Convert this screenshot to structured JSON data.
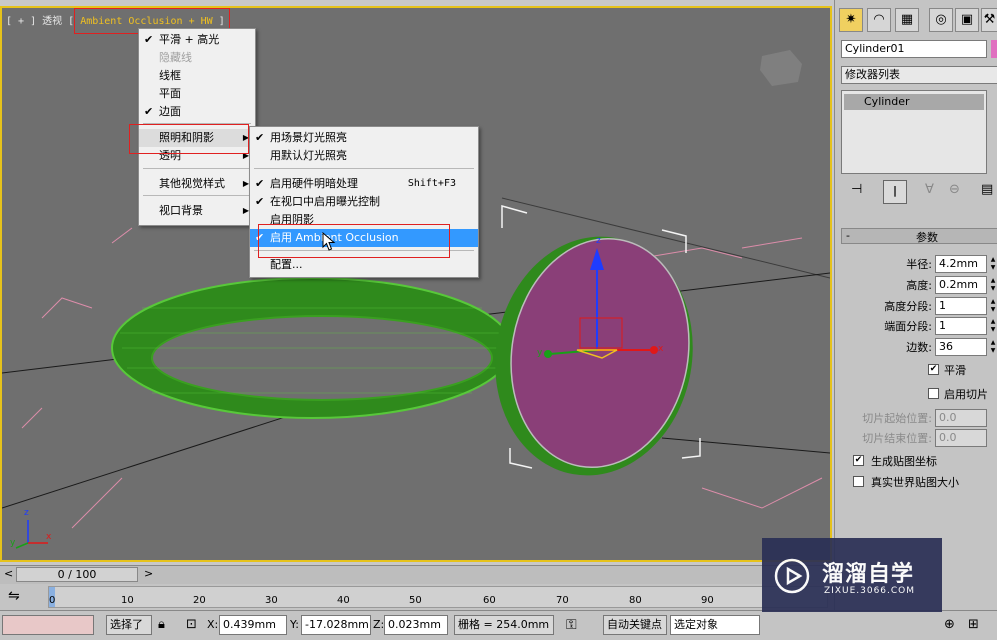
{
  "viewport": {
    "label_prefix": "[ + ] 透视 [",
    "label_mode": "Ambient Occlusion + HW",
    "label_suffix": "]",
    "axis_x": "x",
    "axis_y": "y",
    "axis_z": "z",
    "gizmo_x": "x",
    "gizmo_y": "y",
    "gizmo_z": "z"
  },
  "menu_main": {
    "items": [
      {
        "label": "平滑 + 高光",
        "checked": "✔"
      },
      {
        "label": "隐藏线",
        "checked": ""
      },
      {
        "label": "线框",
        "checked": ""
      },
      {
        "label": "平面",
        "checked": ""
      },
      {
        "label": "边面",
        "checked": "✔"
      },
      {
        "label": "照明和阴影",
        "arrow": "▶"
      },
      {
        "label": "透明",
        "arrow": "▶"
      },
      {
        "label": "其他视觉样式",
        "arrow": "▶"
      },
      {
        "label": "视口背景",
        "arrow": "▶"
      }
    ]
  },
  "menu_sub": {
    "items": [
      {
        "label": "用场景灯光照亮",
        "checked": "✔"
      },
      {
        "label": "用默认灯光照亮",
        "checked": ""
      },
      {
        "label": "启用硬件明暗处理",
        "checked": "✔",
        "shortcut": "Shift+F3"
      },
      {
        "label": "在视口中启用曝光控制",
        "checked": "✔"
      },
      {
        "label": "启用阴影",
        "checked": ""
      },
      {
        "label": "启用 Ambient Occlusion",
        "checked": "✔"
      },
      {
        "label": "配置...",
        "checked": ""
      }
    ]
  },
  "panel": {
    "object_name": "Cylinder01",
    "modifier_list": "修改器列表",
    "stack_item": "Cylinder",
    "rollout_toggle": "-",
    "rollout_title": "参数",
    "params": [
      {
        "label": "半径:",
        "value": "4.2mm"
      },
      {
        "label": "高度:",
        "value": "0.2mm"
      },
      {
        "label": "高度分段:",
        "value": "1"
      },
      {
        "label": "端面分段:",
        "value": "1"
      },
      {
        "label": "边数:",
        "value": "36"
      }
    ],
    "smooth_label": "平滑",
    "smooth_checked": "✔",
    "slice_on_label": "启用切片",
    "slice_from_label": "切片起始位置:",
    "slice_from_value": "0.0",
    "slice_to_label": "切片结束位置:",
    "slice_to_value": "0.0",
    "gen_map_label": "生成贴图坐标",
    "gen_map_checked": "✔",
    "real_world_label": "真实世界贴图大小"
  },
  "timeline": {
    "frame_label": "0 / 100",
    "prev": "<",
    "next": ">",
    "ticks": [
      "0",
      "10",
      "20",
      "30",
      "40",
      "50",
      "60",
      "70",
      "80",
      "90"
    ]
  },
  "status": {
    "selection_label": "选择了",
    "x_label": "X:",
    "x_value": "0.439mm",
    "y_label": "Y:",
    "y_value": "-17.028mm",
    "z_label": "Z:",
    "z_value": "0.023mm",
    "grid_label": "栅格 = 254.0mm",
    "autokey_label": "自动关键点",
    "selected_object": "选定对象"
  },
  "watermark": {
    "title": "溜溜自学",
    "url": "ZIXUE.3066.COM"
  },
  "colors": {
    "viewport_bg": "#6f6f6f",
    "viewport_border": "#e6c21a",
    "ring_green": "#2f8a1c",
    "disc_purple": "#8a3f78",
    "highlight": "#3399ff",
    "annotation_red": "#e02020"
  }
}
